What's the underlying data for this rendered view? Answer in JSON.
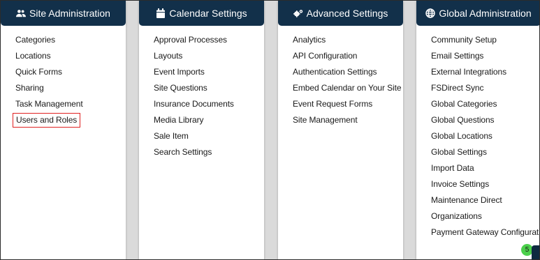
{
  "cards": [
    {
      "title": "Site Administration",
      "icon": "users-cog-icon",
      "links": [
        "Categories",
        "Locations",
        "Quick Forms",
        "Sharing",
        "Task Management",
        "Users and Roles"
      ]
    },
    {
      "title": "Calendar Settings",
      "icon": "calendar-icon",
      "links": [
        "Approval Processes",
        "Layouts",
        "Event Imports",
        "Site Questions",
        "Insurance Documents",
        "Media Library",
        "Sale Item",
        "Search Settings"
      ]
    },
    {
      "title": "Advanced Settings",
      "icon": "cogs-icon",
      "links": [
        "Analytics",
        "API Configuration",
        "Authentication Settings",
        "Embed Calendar on Your Site",
        "Event Request Forms",
        "Site Management"
      ]
    },
    {
      "title": "Global Administration",
      "icon": "globe-icon",
      "links": [
        "Community Setup",
        "Email Settings",
        "External Integrations",
        "FSDirect Sync",
        "Global Categories",
        "Global Questions",
        "Global Locations",
        "Global Settings",
        "Import Data",
        "Invoice Settings",
        "Maintenance Direct",
        "Organizations",
        "Payment Gateway Configurations"
      ]
    }
  ],
  "highlighted_link": "Users and Roles",
  "notification_badge": "5",
  "colors": {
    "header_bg": "#12304a",
    "highlight_border": "#e02020",
    "badge_bg": "#4cd04c"
  }
}
